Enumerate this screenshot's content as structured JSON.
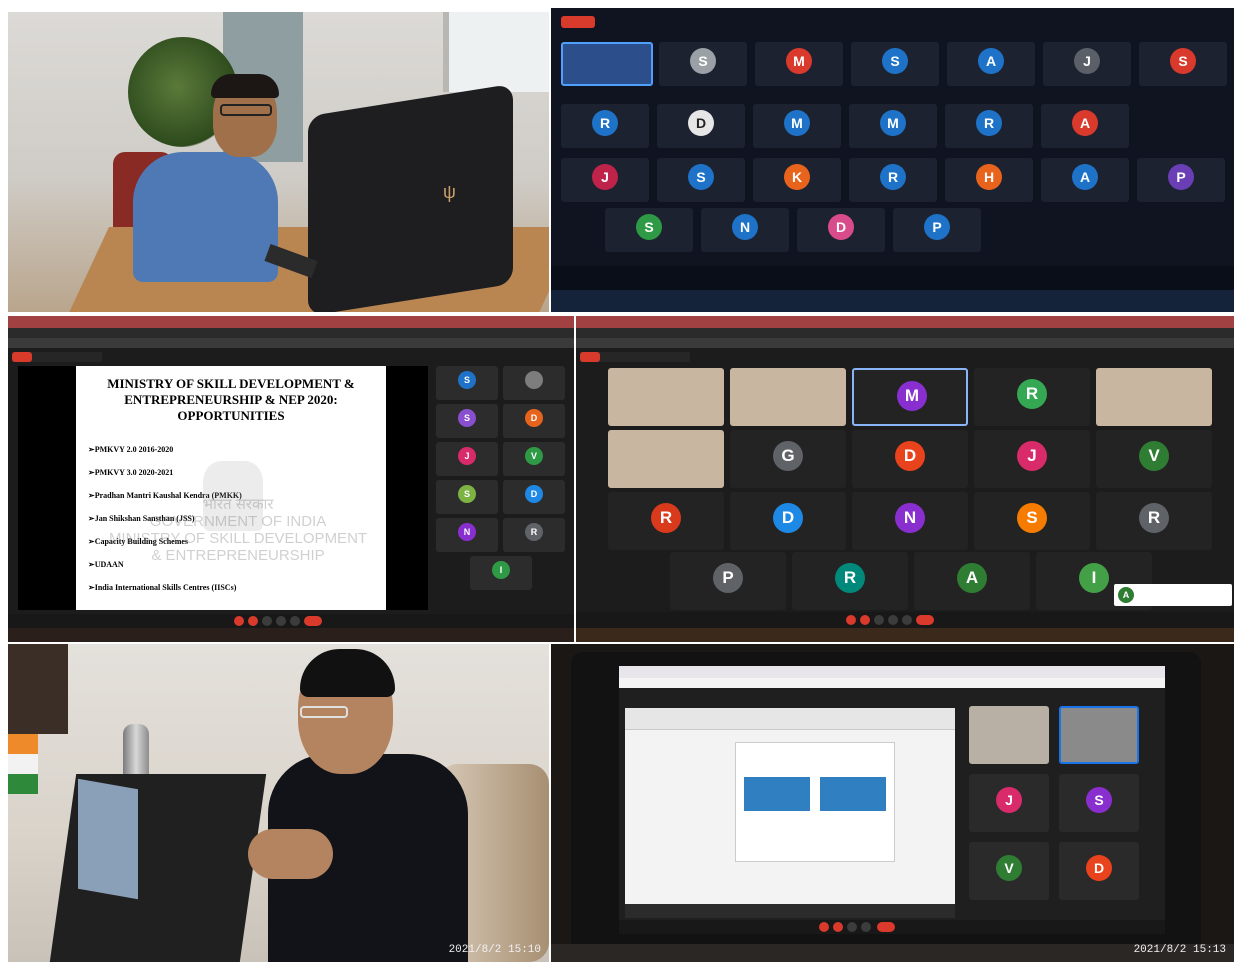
{
  "panel_top_right": {
    "participants": [
      {
        "initial": "S",
        "color": "#9aa0a6"
      },
      {
        "initial": "M",
        "color": "#d93a2b"
      },
      {
        "initial": "S",
        "color": "#1e73c8"
      },
      {
        "initial": "A",
        "color": "#1e73c8"
      },
      {
        "initial": "J",
        "color": "#5a5f68"
      },
      {
        "initial": "S",
        "color": "#d93a2b"
      },
      {
        "initial": "R",
        "color": "#1e73c8"
      },
      {
        "initial": "D",
        "color": "#e6e6e6"
      },
      {
        "initial": "M",
        "color": "#1e73c8"
      },
      {
        "initial": "M",
        "color": "#1e73c8"
      },
      {
        "initial": "R",
        "color": "#1e73c8"
      },
      {
        "initial": "A",
        "color": "#d93a2b"
      },
      {
        "initial": "J",
        "color": "#c0234a"
      },
      {
        "initial": "S",
        "color": "#1e73c8"
      },
      {
        "initial": "K",
        "color": "#e8631c"
      },
      {
        "initial": "R",
        "color": "#1e73c8"
      },
      {
        "initial": "H",
        "color": "#e8631c"
      },
      {
        "initial": "A",
        "color": "#1e73c8"
      },
      {
        "initial": "P",
        "color": "#6a3fb5"
      },
      {
        "initial": "S",
        "color": "#2e9a46"
      },
      {
        "initial": "N",
        "color": "#1e73c8"
      },
      {
        "initial": "D",
        "color": "#d94c8c"
      },
      {
        "initial": "P",
        "color": "#1e73c8"
      }
    ]
  },
  "panel_slide": {
    "slide_title": "MINISTRY OF SKILL DEVELOPMENT & ENTREPRENEURSHIP & NEP 2020: OPPORTUNITIES",
    "bullets": [
      "PMKVY 2.0 2016-2020",
      "PMKVY 3.0 2020-2021",
      "Pradhan Mantri Kaushal Kendra (PMKK)",
      "Jan Shikshan Sansthan (JSS)",
      "Capacity Building Schemes",
      "UDAAN",
      "India International Skills Centres (IISCs)"
    ],
    "watermark_hindi": "भारत सरकार",
    "watermark_lines": [
      "GOVERNMENT OF INDIA",
      "MINISTRY OF SKILL DEVELOPMENT",
      "& ENTREPRENEURSHIP"
    ],
    "side_tiles": [
      {
        "initial": "S",
        "color": "#1e73c8"
      },
      {
        "initial": "",
        "color": "#7d7d7d"
      },
      {
        "initial": "S",
        "color": "#8a4fcf"
      },
      {
        "initial": "D",
        "color": "#e8631c"
      },
      {
        "initial": "J",
        "color": "#d92a6a"
      },
      {
        "initial": "V",
        "color": "#2e9a46"
      },
      {
        "initial": "S",
        "color": "#7cb342"
      },
      {
        "initial": "D",
        "color": "#1e88e5"
      },
      {
        "initial": "N",
        "color": "#8a2fcf"
      },
      {
        "initial": "R",
        "color": "#5f6368"
      },
      {
        "initial": "I",
        "color": "#2e9a46"
      }
    ]
  },
  "panel_gallery": {
    "participants": [
      {
        "initial": "M",
        "color": "#8a2fcf"
      },
      {
        "initial": "R",
        "color": "#34a853"
      },
      {
        "initial": "G",
        "color": "#5f6368"
      },
      {
        "initial": "D",
        "color": "#e8431c"
      },
      {
        "initial": "J",
        "color": "#d92a6a"
      },
      {
        "initial": "V",
        "color": "#2e7d32"
      },
      {
        "initial": "R",
        "color": "#d93a1b"
      },
      {
        "initial": "D",
        "color": "#1e88e5"
      },
      {
        "initial": "N",
        "color": "#8a2fcf"
      },
      {
        "initial": "S",
        "color": "#f57c00"
      },
      {
        "initial": "R",
        "color": "#5f6368"
      },
      {
        "initial": "P",
        "color": "#5f6368"
      },
      {
        "initial": "R",
        "color": "#00897b"
      },
      {
        "initial": "A",
        "color": "#2e7d32"
      },
      {
        "initial": "I",
        "color": "#43a047"
      }
    ],
    "popup_initial": "A",
    "popup_color": "#2e7d32"
  },
  "panel_laptop_man": {
    "timestamp": "2021/8/2 15:10"
  },
  "panel_laptop_screen": {
    "participants": [
      {
        "initial": "J",
        "color": "#d92a6a"
      },
      {
        "initial": "S",
        "color": "#8a2fcf"
      },
      {
        "initial": "V",
        "color": "#2e7d32"
      },
      {
        "initial": "D",
        "color": "#e8431c"
      }
    ],
    "timestamp": "2021/8/2 15:13"
  }
}
